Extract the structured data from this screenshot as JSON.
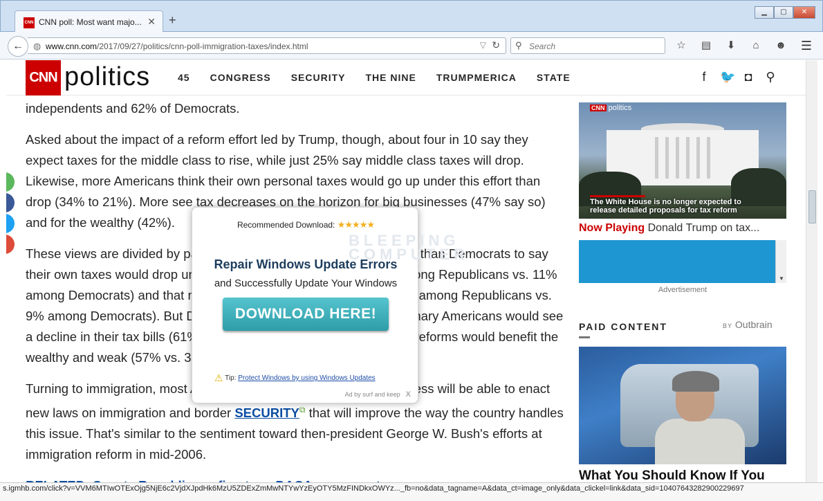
{
  "browser": {
    "tab_title": "CNN poll: Most want majo...",
    "tab_favicon": "CNN",
    "url_host": "www.cnn.com",
    "url_path": "/2017/09/27/politics/cnn-poll-immigration-taxes/index.html",
    "search_placeholder": "Search",
    "new_tab_label": "+",
    "status_url": "s.igmhb.com/click?v=VVM6MTIwOTExOjg5NjE6c2VjdXJpdHk6MzU5ZDExZmMwNTYwYzEyOTY5MzFINDkxOWYz..._fb=no&data_tagname=A&data_ct=image_only&data_clickel=link&data_sid=10407643282900229697"
  },
  "cnn": {
    "logo": "CNN",
    "section_word": "politics",
    "nav": [
      "45",
      "CONGRESS",
      "SECURITY",
      "THE NINE",
      "TRUMPMERICA",
      "STATE"
    ]
  },
  "article": {
    "p1": "independents and 62% of Democrats.",
    "p2": "Asked about the impact of a reform effort led by Trump, though, about four in 10 say they expect taxes for the middle class to rise, while just 25% say middle class taxes will drop. Likewise, more Americans think their own personal taxes would go up under this effort than drop (34% to 21%). More see tax decreases on the horizon for big businesses (47% say so) and for the wealthy (42%).",
    "p3": "These views are divided by partisanship. Republicans are more likely than Democrats to say their own taxes would drop under a Trump-led reform effort (42% among Republicans vs. 11% among Democrats) and that middle-class taxes would go down (49% among Republicans vs. 9% among Democrats). But Democrats are more convinced that ordinary Americans would see a decline in their tax bills (61% vs. 19% of Republicans) and that the reforms would benefit the wealthy and weak (57% vs. 36% among Republicans).",
    "p4_before": "Turning to immigration, most Americans are not optimistic that Congress will be able to enact new laws on immigration and border",
    "p4_link": "SECURITY",
    "p4_after": " that will improve the way the country handles this issue. That's similar to the sentiment toward then-president George W. Bush's efforts at immigration reform in mid-2006.",
    "related": "RELATED: Senate Republicans fine-tune DACA agreement"
  },
  "sidebar": {
    "video_tag": "politics",
    "video_caption": "The White House is no longer expected to release detailed proposals for tax reform",
    "now_playing_label": "Now Playing",
    "now_playing_title": "Donald Trump on tax...",
    "ad_label": "Advertisement",
    "paid_content": "PAID CONTENT",
    "by_label": "BY",
    "outbrain": "Outbrain",
    "headline": "What You Should Know If You"
  },
  "popup": {
    "recommended": "Recommended Download:",
    "stars": "★★★★★",
    "title": "Repair Windows Update Errors",
    "subtitle": "and Successfully Update Your Windows",
    "button": "DOWNLOAD HERE!",
    "tip_label": "Tip:",
    "tip_link": "Protect Windows by using Windows Updates",
    "ad_by": "Ad by surf and keep",
    "close": "X",
    "watermark": "BLEEPING COMPUTER"
  },
  "colors": {
    "cnn_red": "#cc0000",
    "link_blue": "#0c4da2",
    "button_teal": "#3fb0bb",
    "ad_blue": "#1e96d1"
  }
}
